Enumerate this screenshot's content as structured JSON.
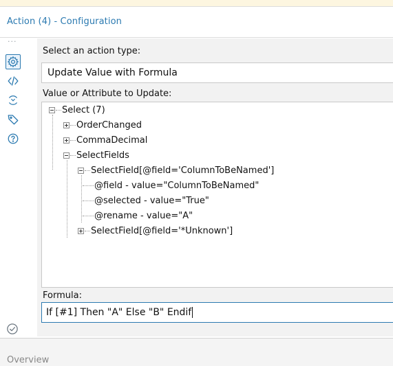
{
  "panel": {
    "title": "Action (4) - Configuration"
  },
  "rail": {
    "items": [
      {
        "icon": "gear-icon",
        "active": true
      },
      {
        "icon": "code-icon",
        "active": false
      },
      {
        "icon": "connection-icon",
        "active": false
      },
      {
        "icon": "tag-icon",
        "active": false
      },
      {
        "icon": "help-icon",
        "active": false
      }
    ],
    "bottom_icon": "check-circle-icon"
  },
  "action_type": {
    "label": "Select an action type:",
    "value": "Update Value with Formula"
  },
  "tree": {
    "label": "Value or Attribute to Update:",
    "nodes": [
      {
        "text": "Select (7)",
        "level": 0,
        "expander": "minus"
      },
      {
        "text": "OrderChanged",
        "level": 1,
        "expander": "plus"
      },
      {
        "text": "CommaDecimal",
        "level": 1,
        "expander": "plus"
      },
      {
        "text": "SelectFields",
        "level": 1,
        "expander": "minus"
      },
      {
        "text": "SelectField[@field='ColumnToBeNamed']",
        "level": 2,
        "expander": "minus"
      },
      {
        "text": "@field - value=\"ColumnToBeNamed\"",
        "level": 3,
        "expander": "none"
      },
      {
        "text": "@selected - value=\"True\"",
        "level": 3,
        "expander": "none"
      },
      {
        "text": "@rename - value=\"A\"",
        "level": 3,
        "expander": "none"
      },
      {
        "text": "SelectField[@field='*Unknown']",
        "level": 2,
        "expander": "plus"
      }
    ]
  },
  "formula": {
    "label": "Formula:",
    "value": "If [#1] Then \"A\" Else \"B\" Endif"
  },
  "overview": {
    "label": "Overview"
  },
  "colors": {
    "accent": "#2a79b0",
    "panel_bg": "#f2f2f2",
    "top_strip": "#fdf6e0"
  }
}
